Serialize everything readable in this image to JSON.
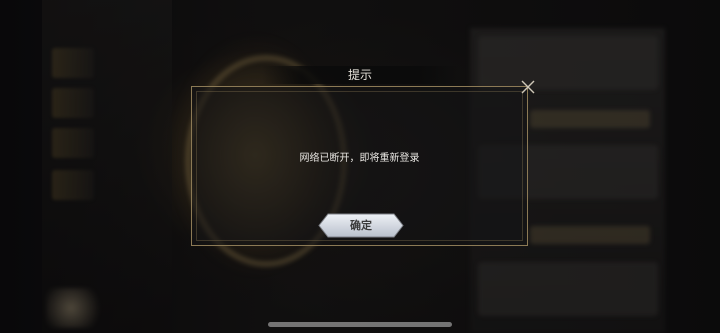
{
  "dialog": {
    "title": "提示",
    "message": "网络已断开，即将重新登录",
    "confirm_label": "确定",
    "close_icon": "close-icon"
  },
  "colors": {
    "dialog_border": "#8c7a55",
    "button_fill": "#d6dbe6",
    "title_text": "#e8e4dc"
  }
}
